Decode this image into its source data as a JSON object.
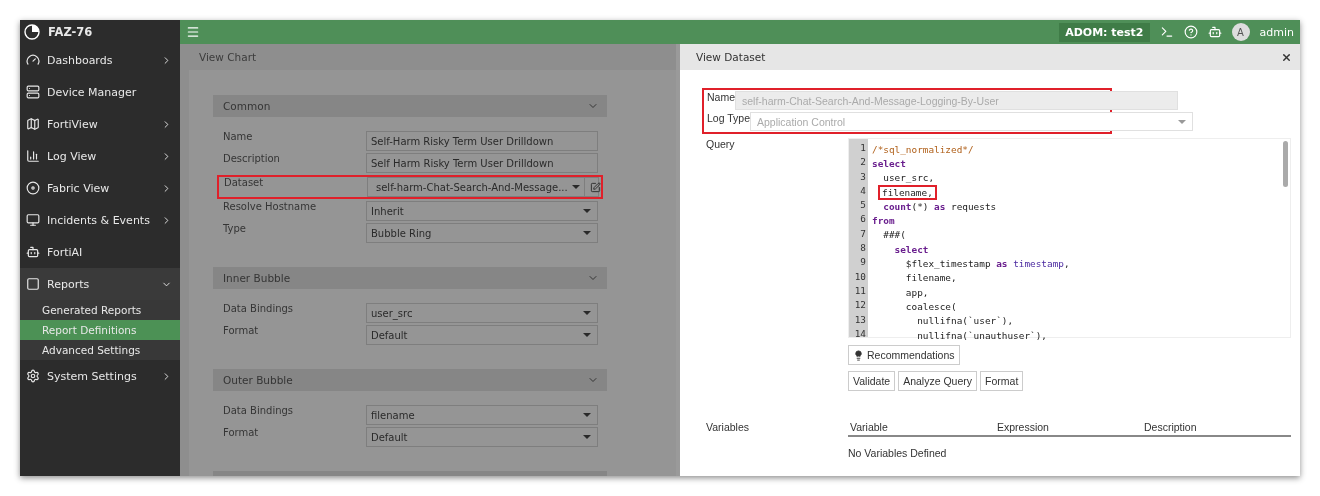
{
  "sidebar": {
    "title": "FAZ-76",
    "items": [
      {
        "label": "Dashboards",
        "expandable": true,
        "expanded": false
      },
      {
        "label": "Device Manager",
        "expandable": false,
        "expanded": false
      },
      {
        "label": "FortiView",
        "expandable": true,
        "expanded": false
      },
      {
        "label": "Log View",
        "expandable": true,
        "expanded": false
      },
      {
        "label": "Fabric View",
        "expandable": true,
        "expanded": false
      },
      {
        "label": "Incidents & Events",
        "expandable": true,
        "expanded": false
      },
      {
        "label": "FortiAI",
        "expandable": false,
        "expanded": false
      },
      {
        "label": "Reports",
        "expandable": true,
        "expanded": true,
        "children": [
          {
            "label": "Generated Reports",
            "selected": false
          },
          {
            "label": "Report Definitions",
            "selected": true
          },
          {
            "label": "Advanced Settings",
            "selected": false
          }
        ]
      },
      {
        "label": "System Settings",
        "expandable": true,
        "expanded": false
      }
    ]
  },
  "topbar": {
    "adom": "ADOM: test2",
    "avatar": "A",
    "user": "admin"
  },
  "view_chart": {
    "title": "View Chart",
    "sections": [
      {
        "title": "Common",
        "fields": [
          {
            "label": "Name",
            "kind": "text",
            "value": "Self-Harm Risky Term User Drilldown",
            "highlighted": false
          },
          {
            "label": "Description",
            "kind": "text",
            "value": "Self Harm Risky Term User Drilldown",
            "highlighted": false
          },
          {
            "label": "Dataset",
            "kind": "dataset",
            "value": "self-harm-Chat-Search-And-Message...",
            "highlighted": true
          },
          {
            "label": "Resolve Hostname",
            "kind": "select",
            "value": "Inherit",
            "highlighted": false
          },
          {
            "label": "Type",
            "kind": "select",
            "value": "Bubble Ring",
            "highlighted": false
          }
        ]
      },
      {
        "title": "Inner Bubble",
        "fields": [
          {
            "label": "Data Bindings",
            "kind": "select",
            "value": "user_src",
            "highlighted": false
          },
          {
            "label": "Format",
            "kind": "select",
            "value": "Default",
            "highlighted": false
          }
        ]
      },
      {
        "title": "Outer Bubble",
        "fields": [
          {
            "label": "Data Bindings",
            "kind": "select",
            "value": "filename",
            "highlighted": false
          },
          {
            "label": "Format",
            "kind": "select",
            "value": "Default",
            "highlighted": false
          }
        ]
      }
    ]
  },
  "view_dataset": {
    "title": "View Dataset",
    "name": {
      "label": "Name",
      "value": "self-harm-Chat-Search-And-Message-Logging-By-User"
    },
    "log_type": {
      "label": "Log Type",
      "value": "Application Control"
    },
    "identity_highlighted": true,
    "query": {
      "label": "Query",
      "lines": [
        {
          "number": "1",
          "highlighted": false,
          "tokens": [
            {
              "kind": "comment",
              "text": "/*sql_normalized*/"
            }
          ]
        },
        {
          "number": "2",
          "highlighted": false,
          "tokens": [
            {
              "kind": "keyword",
              "text": "select"
            }
          ]
        },
        {
          "number": "3",
          "highlighted": false,
          "tokens": [
            {
              "kind": "plain",
              "text": "  user_src,"
            }
          ]
        },
        {
          "number": "4",
          "highlighted": true,
          "tokens": [
            {
              "kind": "plain",
              "text": "filename,"
            }
          ]
        },
        {
          "number": "5",
          "highlighted": false,
          "tokens": [
            {
              "kind": "keyword",
              "text": "  count"
            },
            {
              "kind": "plain",
              "text": "(*) "
            },
            {
              "kind": "keyword",
              "text": "as"
            },
            {
              "kind": "plain",
              "text": " requests"
            }
          ]
        },
        {
          "number": "6",
          "highlighted": false,
          "tokens": [
            {
              "kind": "keyword",
              "text": "from"
            }
          ]
        },
        {
          "number": "7",
          "highlighted": false,
          "tokens": [
            {
              "kind": "plain",
              "text": "  ###("
            }
          ]
        },
        {
          "number": "8",
          "highlighted": false,
          "tokens": [
            {
              "kind": "keyword",
              "text": "    select"
            }
          ]
        },
        {
          "number": "9",
          "highlighted": false,
          "tokens": [
            {
              "kind": "plain",
              "text": "      $flex_timestamp "
            },
            {
              "kind": "keyword",
              "text": "as"
            },
            {
              "kind": "builtin",
              "text": " timestamp"
            },
            {
              "kind": "plain",
              "text": ","
            }
          ]
        },
        {
          "number": "10",
          "highlighted": false,
          "tokens": [
            {
              "kind": "plain",
              "text": "      filename,"
            }
          ]
        },
        {
          "number": "11",
          "highlighted": false,
          "tokens": [
            {
              "kind": "plain",
              "text": "      app,"
            }
          ]
        },
        {
          "number": "12",
          "highlighted": false,
          "tokens": [
            {
              "kind": "plain",
              "text": "      coalesce("
            }
          ]
        },
        {
          "number": "13",
          "highlighted": false,
          "tokens": [
            {
              "kind": "plain",
              "text": "        nullifna(`user`),"
            }
          ]
        },
        {
          "number": "14",
          "highlighted": false,
          "tokens": [
            {
              "kind": "plain",
              "text": "        nullifna(`unauthuser`),"
            }
          ]
        }
      ]
    },
    "recommendations": "Recommendations",
    "buttons": [
      "Validate",
      "Analyze Query",
      "Format"
    ],
    "variables": {
      "label": "Variables",
      "columns": [
        "Variable",
        "Expression",
        "Description"
      ],
      "empty": "No Variables Defined"
    }
  }
}
